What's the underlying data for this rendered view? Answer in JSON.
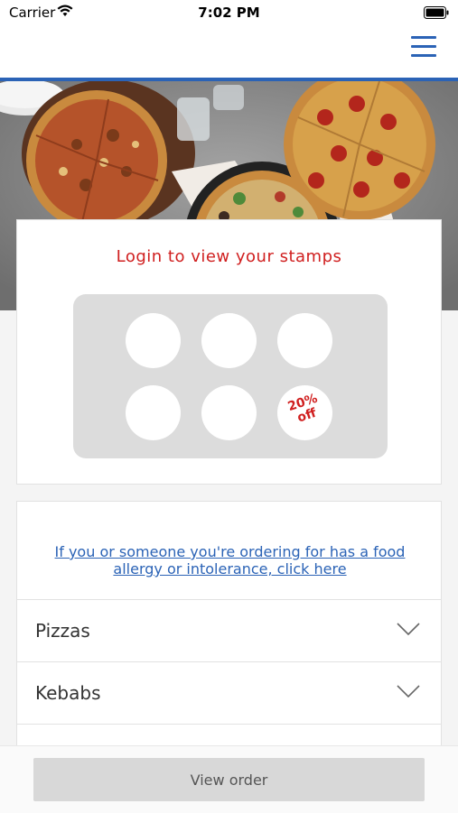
{
  "status_bar": {
    "carrier": "Carrier",
    "time": "7:02 PM",
    "icons": [
      "wifi-icon",
      "battery-icon"
    ]
  },
  "header": {
    "menu_icon": "hamburger-menu-icon",
    "accent_color": "#2b63b6"
  },
  "hero": {
    "image": "pizzas-on-table"
  },
  "stamps": {
    "title": "Login to view your stamps",
    "reward_label": "20%\noff",
    "title_color": "#d01f1f"
  },
  "allergy": {
    "link_text": "If you or someone you're ordering for has a food allergy or intolerance, click here",
    "link_color": "#2b63b6"
  },
  "categories": [
    {
      "label": "Pizzas",
      "icon": "chevron-down-icon"
    },
    {
      "label": "Kebabs",
      "icon": "chevron-down-icon"
    }
  ],
  "footer": {
    "view_order_label": "View order"
  }
}
